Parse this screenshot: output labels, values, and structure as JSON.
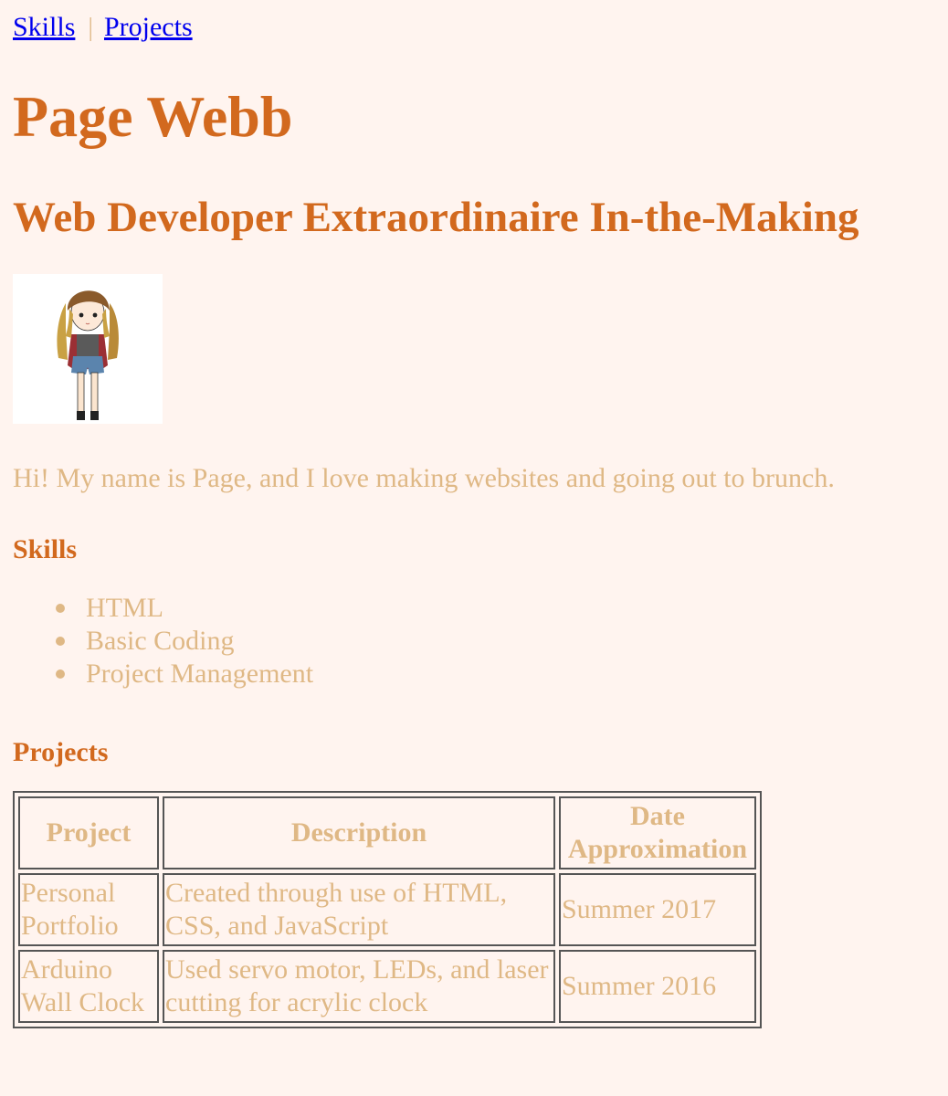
{
  "nav": {
    "links": [
      "Skills",
      "Projects"
    ],
    "separator": "|"
  },
  "profile": {
    "name": "Page Webb",
    "tagline": "Web Developer Extraordinaire In-the-Making",
    "bio": "Hi! My name is Page, and I love making websites and going out to brunch."
  },
  "skills": {
    "heading": "Skills",
    "items": [
      "HTML",
      "Basic Coding",
      "Project Management"
    ]
  },
  "projects": {
    "heading": "Projects",
    "columns": [
      "Project",
      "Description",
      "Date Approximation"
    ],
    "rows": [
      [
        "Personal Portfolio",
        "Created through use of HTML, CSS, and JavaScript",
        "Summer 2017"
      ],
      [
        "Arduino Wall Clock",
        "Used servo motor, LEDs, and laser cutting for acrylic clock",
        "Summer 2016"
      ]
    ]
  },
  "colors": {
    "background": "#fff4ef",
    "heading": "#d2691e",
    "text": "#dfb885",
    "link": "#0000ee",
    "table_border": "#555555"
  },
  "icons": {
    "avatar": "cartoon-girl-avatar"
  }
}
